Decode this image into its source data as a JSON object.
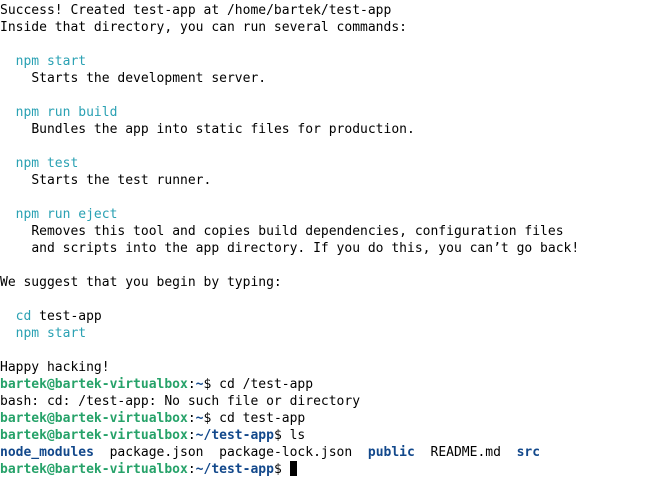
{
  "colors": {
    "background": "#ffffff",
    "text": "#000000",
    "command": "#2aa1b3",
    "prompt_user_host": "#26a269",
    "prompt_path": "#12488b",
    "directory": "#12488b"
  },
  "output": {
    "success": "Success! Created test-app at /home/bartek/test-app",
    "inside": "Inside that directory, you can run several commands:",
    "commands": [
      {
        "cmd": "npm start",
        "desc": [
          "Starts the development server."
        ]
      },
      {
        "cmd": "npm run build",
        "desc": [
          "Bundles the app into static files for production."
        ]
      },
      {
        "cmd": "npm test",
        "desc": [
          "Starts the test runner."
        ]
      },
      {
        "cmd": "npm run eject",
        "desc": [
          "Removes this tool and copies build dependencies, configuration files",
          "and scripts into the app directory. If you do this, you can’t go back!"
        ]
      }
    ],
    "suggest": "We suggest that you begin by typing:",
    "suggest_cd_cmd": "cd",
    "suggest_cd_arg": "test-app",
    "suggest_start": "npm start",
    "happy": "Happy hacking!"
  },
  "session": [
    {
      "user_host": "bartek@bartek-virtualbox",
      "sep": ":",
      "path": "~",
      "symbol": "$ ",
      "input": "cd /test-app"
    },
    {
      "output": "bash: cd: /test-app: No such file or directory"
    },
    {
      "user_host": "bartek@bartek-virtualbox",
      "sep": ":",
      "path": "~",
      "symbol": "$ ",
      "input": "cd test-app"
    },
    {
      "user_host": "bartek@bartek-virtualbox",
      "sep": ":",
      "path": "~/test-app",
      "symbol": "$ ",
      "input": "ls"
    }
  ],
  "ls_listing": [
    {
      "name": "node_modules",
      "type": "dir"
    },
    {
      "name": "package.json",
      "type": "file"
    },
    {
      "name": "package-lock.json",
      "type": "file"
    },
    {
      "name": "public",
      "type": "dir"
    },
    {
      "name": "README.md",
      "type": "file"
    },
    {
      "name": "src",
      "type": "dir"
    }
  ],
  "current_prompt": {
    "user_host": "bartek@bartek-virtualbox",
    "sep": ":",
    "path": "~/test-app",
    "symbol": "$ "
  }
}
